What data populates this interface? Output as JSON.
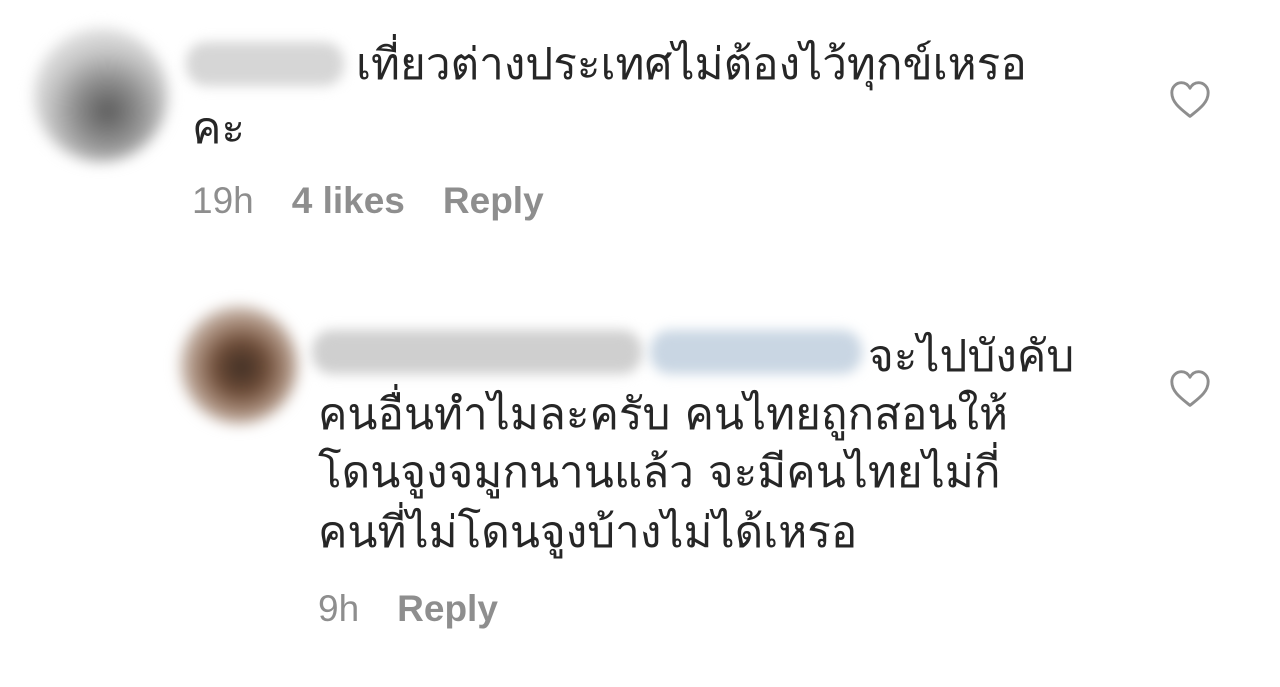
{
  "comments": [
    {
      "text_line1": "เที่ยวต่างประเทศไม่ต้องไว้ทุกข์เหรอ",
      "text_line2": "คะ",
      "time": "19h",
      "likes": "4 likes",
      "reply": "Reply",
      "like_icon": "heart-outline-icon"
    },
    {
      "text_line1": "จะไปบังคับ",
      "text_line2": "คนอื่นทำไมละครับ คนไทยถูกสอนให้",
      "text_line3": "โดนจูงจมูกนานแล้ว จะมีคนไทยไม่กี่",
      "text_line4": "คนที่ไม่โดนจูงบ้างไม่ได้เหรอ",
      "time": "9h",
      "reply": "Reply",
      "like_icon": "heart-outline-icon"
    }
  ],
  "colors": {
    "text": "#262626",
    "meta": "#8e8e8e",
    "background": "#ffffff"
  }
}
